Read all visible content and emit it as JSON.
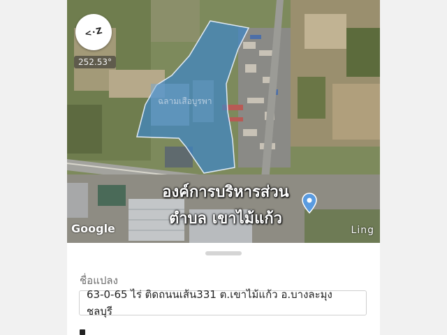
{
  "map": {
    "compass_label": "<·Z",
    "heading": "252.53°",
    "parcel_label": "ฉลามเสือบูรพา",
    "overlay_line1": "องค์การบริหารส่วน",
    "overlay_line2": "ตำบล เขาไม้แก้ว",
    "google_logo": "Google",
    "ling_logo": "Ling",
    "parcel_color": "#3e86c6",
    "pin_color": "#5a9be0"
  },
  "sheet": {
    "field_label": "ชื่อแปลง",
    "field_value": "63-0-65 ไร่ ติดถนนเส้น331 ต.เขาไม้แก้ว อ.บางละมุง ชลบุรี"
  }
}
